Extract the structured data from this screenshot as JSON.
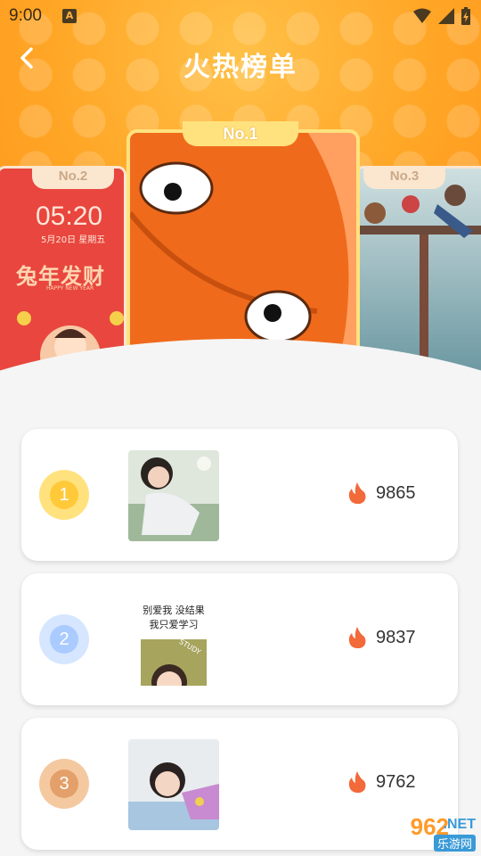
{
  "status_bar": {
    "time": "9:00",
    "a_icon": "A"
  },
  "header": {
    "title": "火热榜单",
    "back_icon": "back-arrow-icon"
  },
  "podium": [
    {
      "rank_label": "No.1",
      "wallpaper": "orange-monster"
    },
    {
      "rank_label": "No.2",
      "wallpaper": "rabbit-year-lockscreen",
      "time": "05:20",
      "date": "5月20日 星期五",
      "headline": "兔年发财",
      "subline": "HAPPY NEW YEAR"
    },
    {
      "rank_label": "No.3",
      "wallpaper": "anime-pier-scene"
    }
  ],
  "ranking": [
    {
      "rank": "1",
      "medal_color": "#ffd34d",
      "heat": "9865",
      "thumb": "girl-photo"
    },
    {
      "rank": "2",
      "medal_color": "#9ec6ff",
      "heat": "9837",
      "thumb": "study-cartoon",
      "thumb_text_1": "别爱我 没结果",
      "thumb_text_2": "我只爱学习",
      "thumb_sticker": "STUDY"
    },
    {
      "rank": "3",
      "medal_color": "#e9a870",
      "heat": "9762",
      "thumb": "girl-flowers-photo"
    }
  ],
  "watermark": {
    "text_1": "962",
    "text_2": ".NET",
    "text_3": "乐游网"
  }
}
